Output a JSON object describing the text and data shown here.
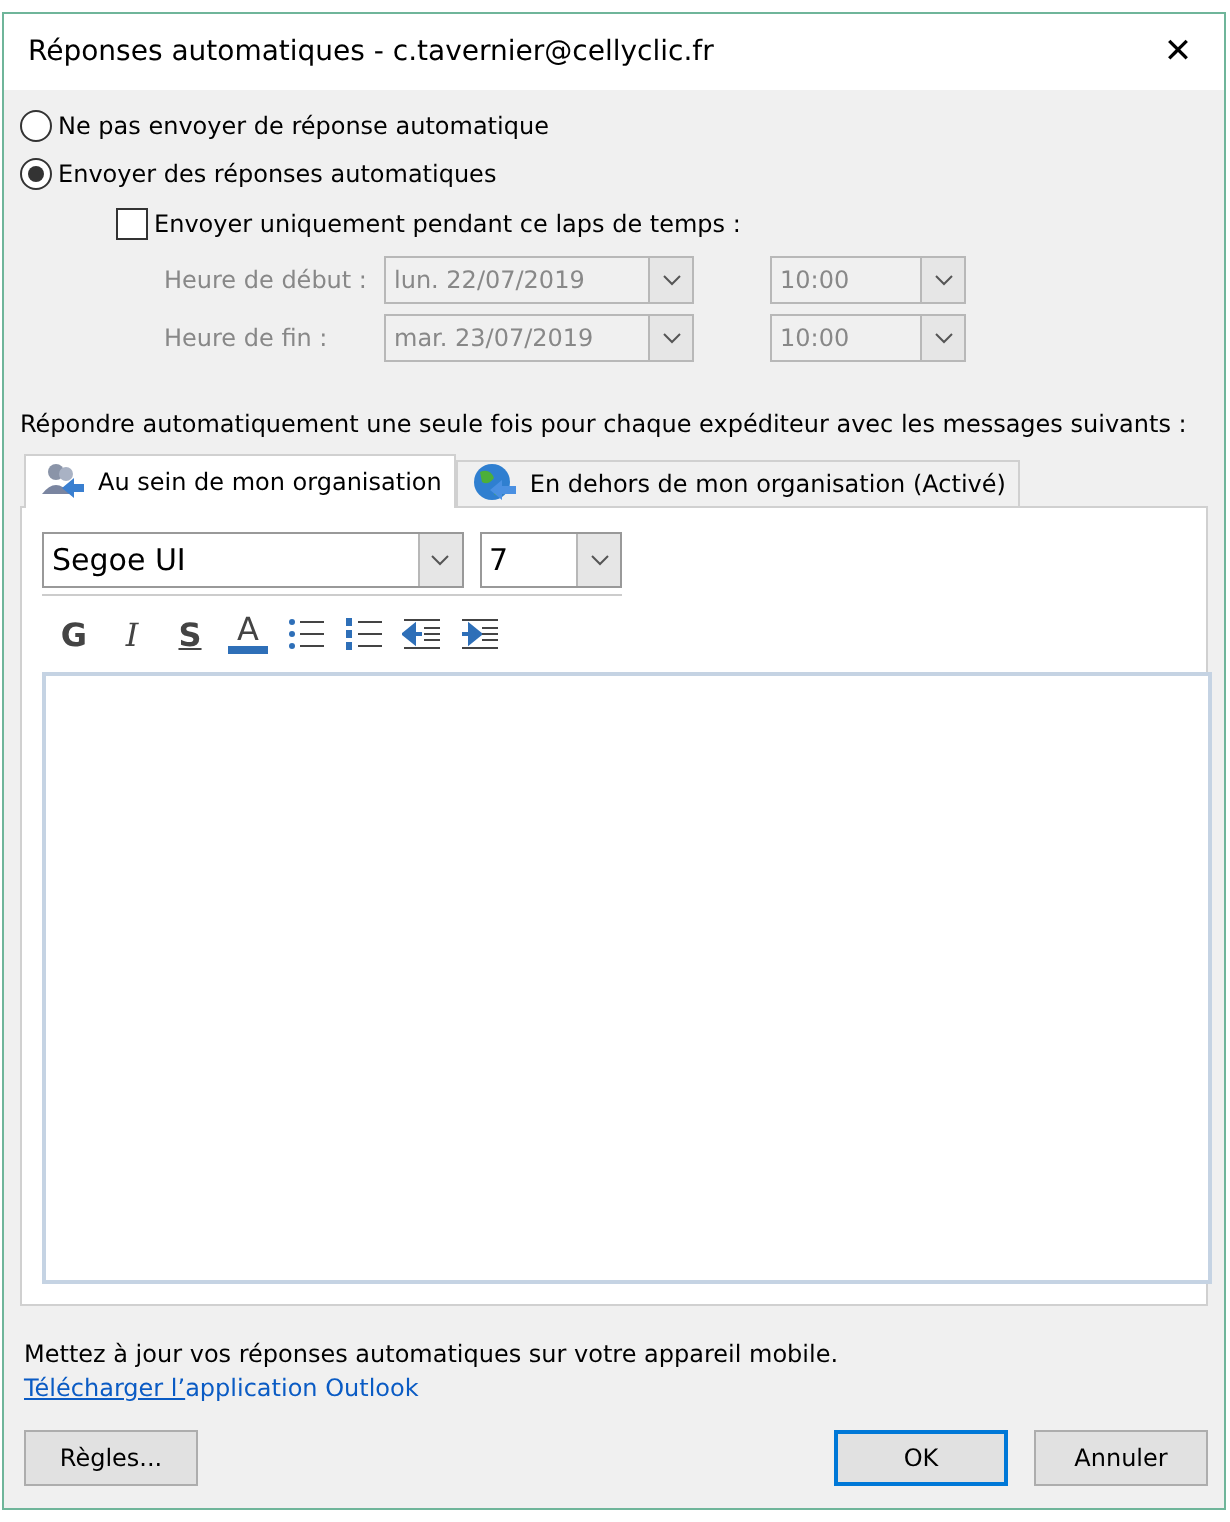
{
  "window": {
    "title": "Réponses automatiques - c.tavernier@cellyclic.fr",
    "close": "✕"
  },
  "reply_mode": [
    {
      "label": "Ne pas envoyer de réponse automatique",
      "selected": false
    },
    {
      "label": "Envoyer des réponses automatiques",
      "selected": true
    }
  ],
  "time_range": {
    "label": "Envoyer uniquement pendant ce laps de temps :",
    "checked": false,
    "disabled": true,
    "rows": [
      {
        "label": "Heure de début :",
        "date": "lun. 22/07/2019",
        "time": "10:00"
      },
      {
        "label": "Heure de fin :",
        "date": "mar. 23/07/2019",
        "time": "10:00"
      }
    ]
  },
  "instructions": "Répondre automatiquement une seule fois pour chaque expéditeur avec les messages suivants :",
  "tabs": [
    {
      "label": "Au sein de mon organisation",
      "kind": "people",
      "selected": true
    },
    {
      "label": "En dehors de mon organisation (Activé)",
      "kind": "globe",
      "selected": false
    }
  ],
  "editor": {
    "font": "Segoe UI",
    "size": "7",
    "format_buttons": [
      {
        "kind": "bold",
        "label": "G"
      },
      {
        "kind": "italic",
        "label": "I"
      },
      {
        "kind": "underline",
        "label": "S"
      },
      {
        "kind": "color",
        "label": "A"
      },
      {
        "kind": "bullets"
      },
      {
        "kind": "numbering"
      },
      {
        "kind": "outdent"
      },
      {
        "kind": "indent"
      }
    ]
  },
  "mobile_note": {
    "text": "Mettez à jour vos réponses automatiques sur votre appareil mobile.",
    "link_lines": [
      "Télécharger l’",
      "application Outlook"
    ]
  },
  "buttons": {
    "rules": "Règles...",
    "ok": "OK",
    "cancel": "Annuler"
  }
}
